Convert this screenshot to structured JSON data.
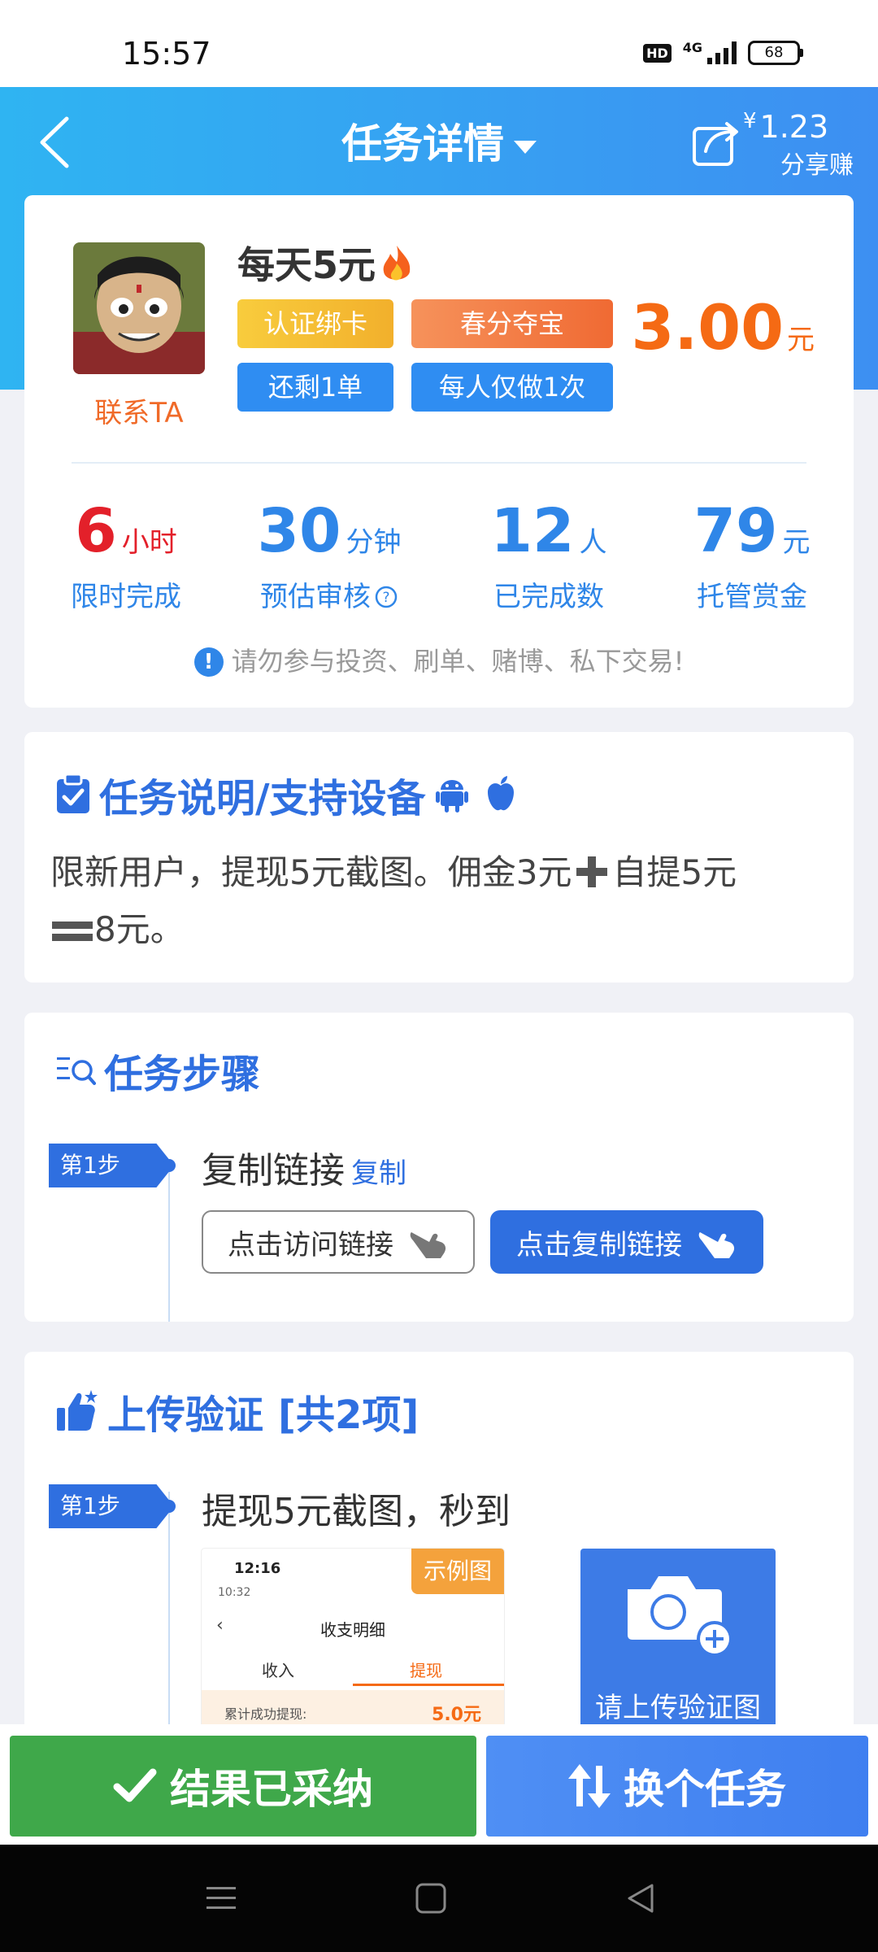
{
  "status_bar": {
    "time": "15:57",
    "hd": "HD",
    "network": "4G",
    "battery": "68"
  },
  "header": {
    "title": "任务详情",
    "share_currency": "¥",
    "share_amount": "1.23",
    "share_label": "分享赚"
  },
  "task": {
    "name": "每天5元",
    "contact_label": "联系TA",
    "tags": [
      "认证绑卡",
      "春分夺宝",
      "还剩1单",
      "每人仅做1次"
    ],
    "price": "3.00",
    "price_unit": "元",
    "stats": [
      {
        "value": "6",
        "unit": "小时",
        "label": "限时完成",
        "color": "#e3202a"
      },
      {
        "value": "30",
        "unit": "分钟",
        "label": "预估审核",
        "color": "#2f86e8"
      },
      {
        "value": "12",
        "unit": "人",
        "label": "已完成数",
        "color": "#2f86e8"
      },
      {
        "value": "79",
        "unit": "元",
        "label": "托管赏金",
        "color": "#2f86e8"
      }
    ],
    "warning": "请勿参与投资、刷单、赌博、私下交易!"
  },
  "description": {
    "title": "任务说明/支持设备",
    "text_part1": "限新用户，提现5元截图。佣金3元",
    "text_part2": "自提5元",
    "text_part3": "8元。"
  },
  "steps": {
    "title": "任务步骤",
    "badge": "第1步",
    "step_text": "复制链接",
    "copy_label": "复制",
    "visit_button": "点击访问链接",
    "copy_button": "点击复制链接"
  },
  "upload": {
    "title": "上传验证",
    "count_label": "[共2项]",
    "badge": "第1步",
    "step_text": "提现5元截图，秒到",
    "example": {
      "badge": "示例图",
      "time": "12:16",
      "sub": "10:32",
      "back": "‹",
      "page_title": "收支明细",
      "tab_income": "收入",
      "tab_withdraw": "提现",
      "row_label": "累计成功提现:",
      "row_value": "5.0元"
    },
    "upload_label": "请上传验证图"
  },
  "bottom": {
    "accepted_label": "结果已采纳",
    "switch_label": "换个任务"
  },
  "colors": {
    "header_gradient_start": "#2fb4f2",
    "header_gradient_end": "#3d8ff2",
    "accent_blue": "#2f6fe0",
    "price_orange": "#f56a14",
    "accepted_green": "#3fa84a"
  }
}
